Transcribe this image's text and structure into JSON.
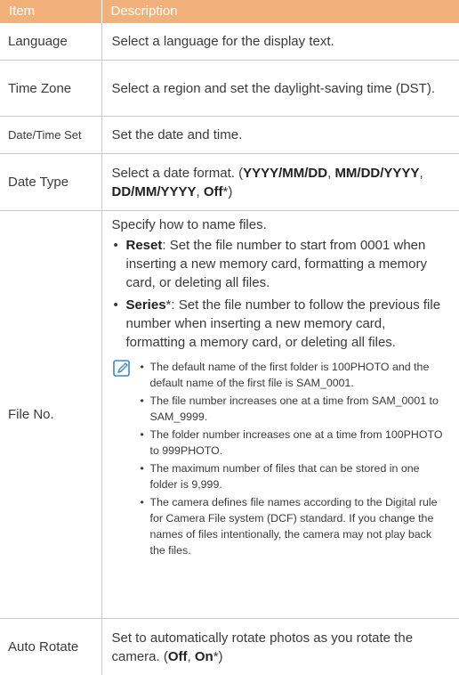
{
  "header": {
    "item": "Item",
    "description": "Description"
  },
  "rows": {
    "language": {
      "item": "Language",
      "desc": "Select a language for the display text."
    },
    "timezone": {
      "item": "Time Zone",
      "desc": "Select a region and set the daylight-saving time (DST)."
    },
    "datetime": {
      "item": "Date/Time Set",
      "desc": "Set the date and time."
    },
    "datetype": {
      "item": "Date Type",
      "desc_prefix": "Select a date format. (",
      "opt1": "YYYY/MM/DD",
      "sep1": ", ",
      "opt2": "MM/DD/YYYY",
      "sep2": ", ",
      "opt3": "DD/MM/YYYY",
      "sep3": ", ",
      "opt4": "Off",
      "suffix": "*)"
    },
    "fileno": {
      "item": "File No.",
      "intro": "Specify how to name files.",
      "bullets": [
        {
          "term": "Reset",
          "text": ": Set the file number to start from 0001 when inserting a new memory card, formatting a memory card, or deleting all files."
        },
        {
          "term": "Series",
          "text": "*: Set the file number to follow the previous file number when inserting a new memory card, formatting a memory card, or deleting all files."
        }
      ],
      "notes": [
        "The default name of the first folder is 100PHOTO and the default name of the first file is SAM_0001.",
        "The file number increases one at a time from SAM_0001 to SAM_9999.",
        "The folder number increases one at a time from 100PHOTO to 999PHOTO.",
        "The maximum number of files that can be stored in one folder is 9,999.",
        "The camera defines file names according to the Digital rule for Camera File system (DCF) standard. If you change the names of files intentionally, the camera may not play back the files."
      ]
    },
    "autorotate": {
      "item": "Auto Rotate",
      "desc_prefix": "Set to automatically rotate photos as you rotate the camera. (",
      "opt1": "Off",
      "sep1": ", ",
      "opt2": "On",
      "suffix": "*)"
    }
  },
  "glyphs": {
    "bullet": "•"
  },
  "icons": {
    "note": "note-pencil-icon"
  },
  "colors": {
    "header_bg": "#f2b17a",
    "icon": "#3a8ac4"
  }
}
